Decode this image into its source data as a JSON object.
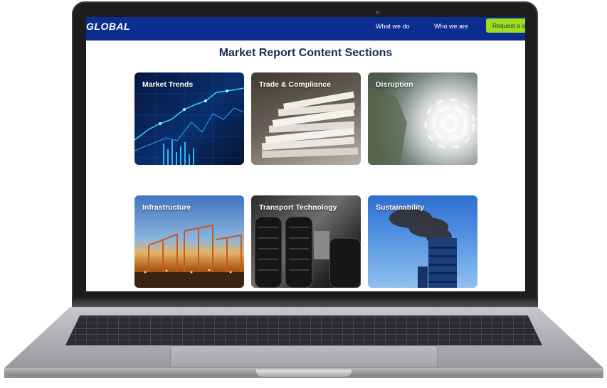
{
  "header": {
    "logo": "GLOBAL",
    "nav": {
      "what_we_do": "What we do",
      "who_we_are": "Who we are",
      "cta": "Request a qu"
    }
  },
  "main": {
    "title": "Market Report Content Sections",
    "cards": [
      {
        "label": "Market Trends"
      },
      {
        "label": "Trade & Compliance"
      },
      {
        "label": "Disruption"
      },
      {
        "label": "Infrastructure"
      },
      {
        "label": "Transport Technology"
      },
      {
        "label": "Sustainability"
      }
    ]
  },
  "colors": {
    "nav_bg": "#0a2d8f",
    "cta_bg": "#9fdc1e",
    "title": "#152e55"
  }
}
